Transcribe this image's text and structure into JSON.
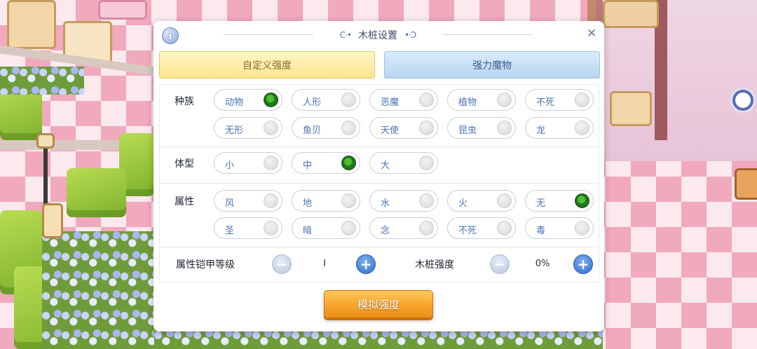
{
  "dialog": {
    "title": "木桩设置",
    "title_ornament_left": "C·•",
    "title_ornament_right": "•·Ɔ",
    "info_icon": "i",
    "close_icon": "✕"
  },
  "tabs": [
    {
      "label": "自定义强度",
      "active": true
    },
    {
      "label": "强力魔物",
      "active": false
    }
  ],
  "race": {
    "label": "种族",
    "options": [
      {
        "label": "动物",
        "selected": true
      },
      {
        "label": "人形",
        "selected": false
      },
      {
        "label": "恶魔",
        "selected": false
      },
      {
        "label": "植物",
        "selected": false
      },
      {
        "label": "不死",
        "selected": false
      },
      {
        "label": "无形",
        "selected": false
      },
      {
        "label": "鱼贝",
        "selected": false
      },
      {
        "label": "天使",
        "selected": false
      },
      {
        "label": "昆虫",
        "selected": false
      },
      {
        "label": "龙",
        "selected": false
      }
    ]
  },
  "size": {
    "label": "体型",
    "options": [
      {
        "label": "小",
        "selected": false
      },
      {
        "label": "中",
        "selected": true
      },
      {
        "label": "大",
        "selected": false
      }
    ]
  },
  "element": {
    "label": "属性",
    "options": [
      {
        "label": "风",
        "selected": false
      },
      {
        "label": "地",
        "selected": false
      },
      {
        "label": "水",
        "selected": false
      },
      {
        "label": "火",
        "selected": false
      },
      {
        "label": "无",
        "selected": true
      },
      {
        "label": "圣",
        "selected": false
      },
      {
        "label": "暗",
        "selected": false
      },
      {
        "label": "念",
        "selected": false
      },
      {
        "label": "不死",
        "selected": false
      },
      {
        "label": "毒",
        "selected": false
      }
    ]
  },
  "armor_level": {
    "label": "属性铠甲等级",
    "value": "I",
    "minus": "−",
    "plus": "+"
  },
  "dummy_strength": {
    "label": "木桩强度",
    "value": "0%",
    "minus": "−",
    "plus": "+"
  },
  "simulate_button": "模拟强度",
  "colors": {
    "tab_active": "#fde58e",
    "tab_inactive": "#b8d6f1",
    "toggle_on": "#2e9b25",
    "chip_text": "#4b72b8",
    "simulate_button": "#f6a52c"
  }
}
